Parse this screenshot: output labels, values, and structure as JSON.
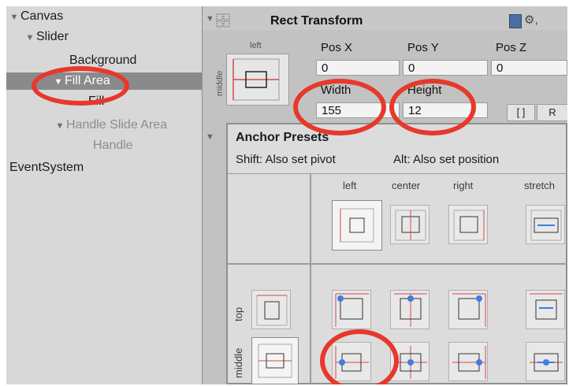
{
  "hierarchy": {
    "items": [
      {
        "label": "Canvas",
        "arrow": "▼"
      },
      {
        "label": "Slider",
        "arrow": "▼"
      },
      {
        "label": "Background",
        "arrow": ""
      },
      {
        "label": "Fill Area",
        "arrow": "▼"
      },
      {
        "label": "Fill",
        "arrow": ""
      },
      {
        "label": "Handle Slide Area",
        "arrow": "▼"
      },
      {
        "label": "Handle",
        "arrow": ""
      },
      {
        "label": "EventSystem",
        "arrow": ""
      }
    ]
  },
  "inspector": {
    "component_title": "Rect Transform",
    "anchor_top_label": "left",
    "anchor_side_label": "middle",
    "pos_x_label": "Pos X",
    "pos_y_label": "Pos Y",
    "pos_z_label": "Pos Z",
    "pos_x_value": "0",
    "pos_y_value": "0",
    "pos_z_value": "0",
    "width_label": "Width",
    "height_label": "Height",
    "width_value": "155",
    "height_value": "12",
    "blueprint_button": "[ ]",
    "raw_button": "R"
  },
  "anchor_presets": {
    "title": "Anchor Presets",
    "hint_shift": "Shift: Also set pivot",
    "hint_alt": "Alt: Also set position",
    "columns": [
      "left",
      "center",
      "right",
      "stretch"
    ],
    "rows": [
      "top",
      "middle"
    ]
  },
  "colors": {
    "annotation": "#e8382c",
    "anchor_red": "#d24a4a",
    "pivot_blue": "#3f7ee0"
  }
}
